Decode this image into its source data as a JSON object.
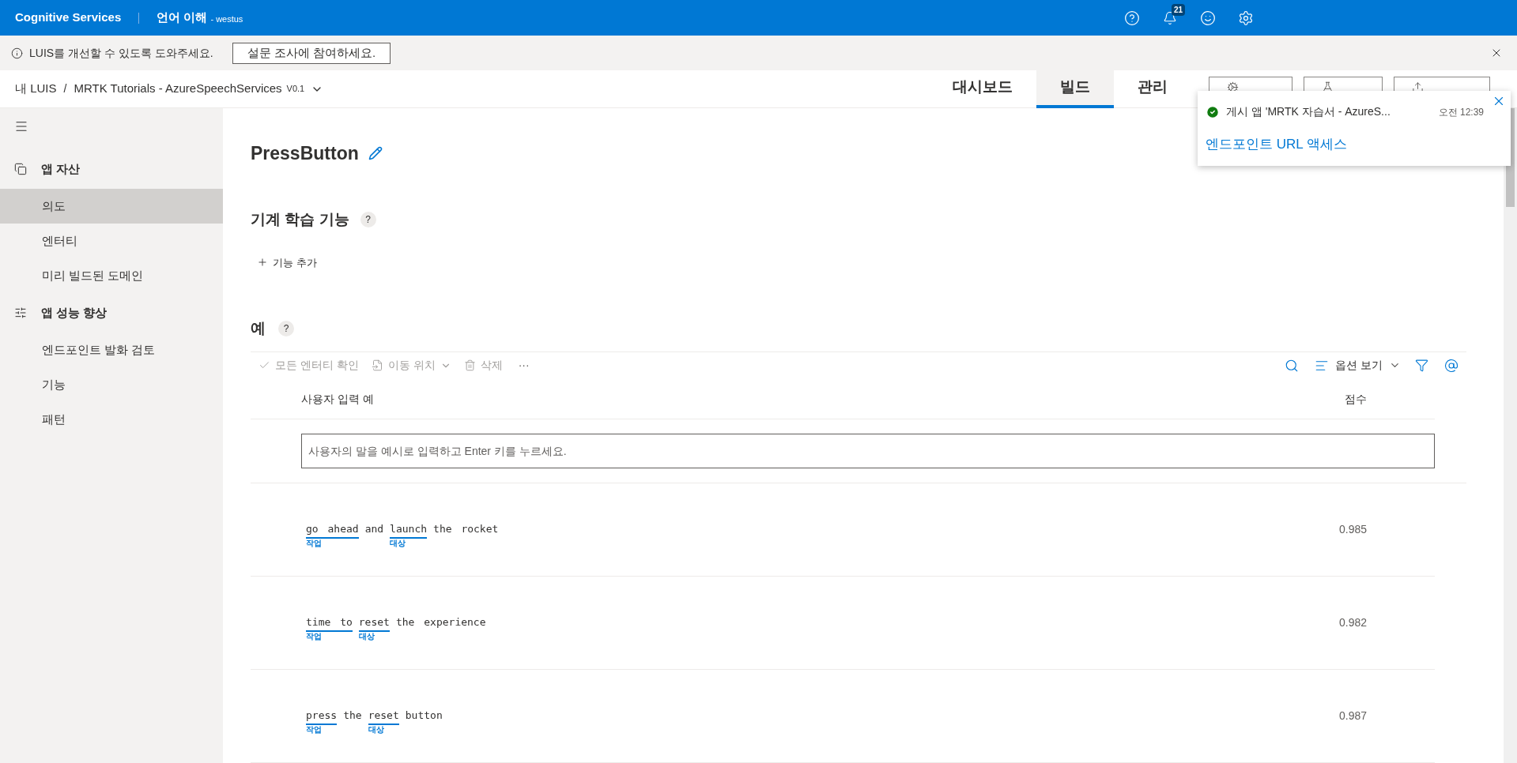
{
  "header": {
    "brand": "Cognitive Services",
    "service": "언어 이해",
    "region": "- westus",
    "notification_count": "21"
  },
  "survey": {
    "message": "LUIS를 개선할 수 있도록 도와주세요.",
    "button": "설문 조사에 참여하세요."
  },
  "breadcrumb": {
    "root": "내 LUIS",
    "separator": "/",
    "app": "MRTK Tutorials - AzureSpeechServices",
    "version": "V0.1"
  },
  "tabs": [
    {
      "label": "대시보드",
      "selected": false
    },
    {
      "label": "빌드",
      "selected": true
    },
    {
      "label": "관리",
      "selected": false
    }
  ],
  "actions": [
    {
      "kind": "train"
    },
    {
      "kind": "test"
    },
    {
      "kind": "publish"
    }
  ],
  "notification": {
    "message": "게시 앱 'MRTK 자습서 - AzureS...",
    "time": "오전 12:39",
    "link": "엔드포인트 URL 액세스"
  },
  "sidebar": {
    "sections": [
      {
        "title": "앱 자산",
        "kind": "assets",
        "items": [
          {
            "label": "의도",
            "selected": true
          },
          {
            "label": "엔터티",
            "selected": false
          },
          {
            "label": "미리 빌드된 도메인",
            "selected": false
          }
        ]
      },
      {
        "title": "앱 성능 향상",
        "kind": "tune",
        "items": [
          {
            "label": "엔드포인트 발화 검토",
            "selected": false
          },
          {
            "label": "기능",
            "selected": false
          },
          {
            "label": "패턴",
            "selected": false
          }
        ]
      }
    ]
  },
  "intent": {
    "title": "PressButton"
  },
  "features": {
    "title": "기계 학습 기능",
    "help": "?",
    "add": "기능 추가"
  },
  "examples": {
    "title": "예",
    "help": "?",
    "toolbar_left": [
      {
        "label": "모든 엔터티 확인",
        "kind": "check"
      },
      {
        "label": "이동 위치",
        "kind": "move"
      },
      {
        "label": "삭제",
        "kind": "delete"
      }
    ],
    "more": "···",
    "view_options": "옵션 보기",
    "columns": [
      "사용자 입력 예",
      "점수"
    ],
    "input_placeholder": "사용자의 말을 예시로 입력하고 Enter 키를 누르세요.",
    "rows": [
      {
        "score": "0.985",
        "segments": [
          {
            "text": "go ahead",
            "label": "작업"
          },
          {
            "text": "and"
          },
          {
            "text": "launch",
            "label": "대상"
          },
          {
            "text": "the rocket"
          }
        ]
      },
      {
        "score": "0.982",
        "segments": [
          {
            "text": "time to",
            "label": "작업"
          },
          {
            "text": "reset",
            "label": "대상"
          },
          {
            "text": "the experience"
          }
        ]
      },
      {
        "score": "0.987",
        "segments": [
          {
            "text": "press",
            "label": "작업"
          },
          {
            "text": "the"
          },
          {
            "text": "reset",
            "label": "대상"
          },
          {
            "text": "button"
          }
        ]
      }
    ]
  }
}
